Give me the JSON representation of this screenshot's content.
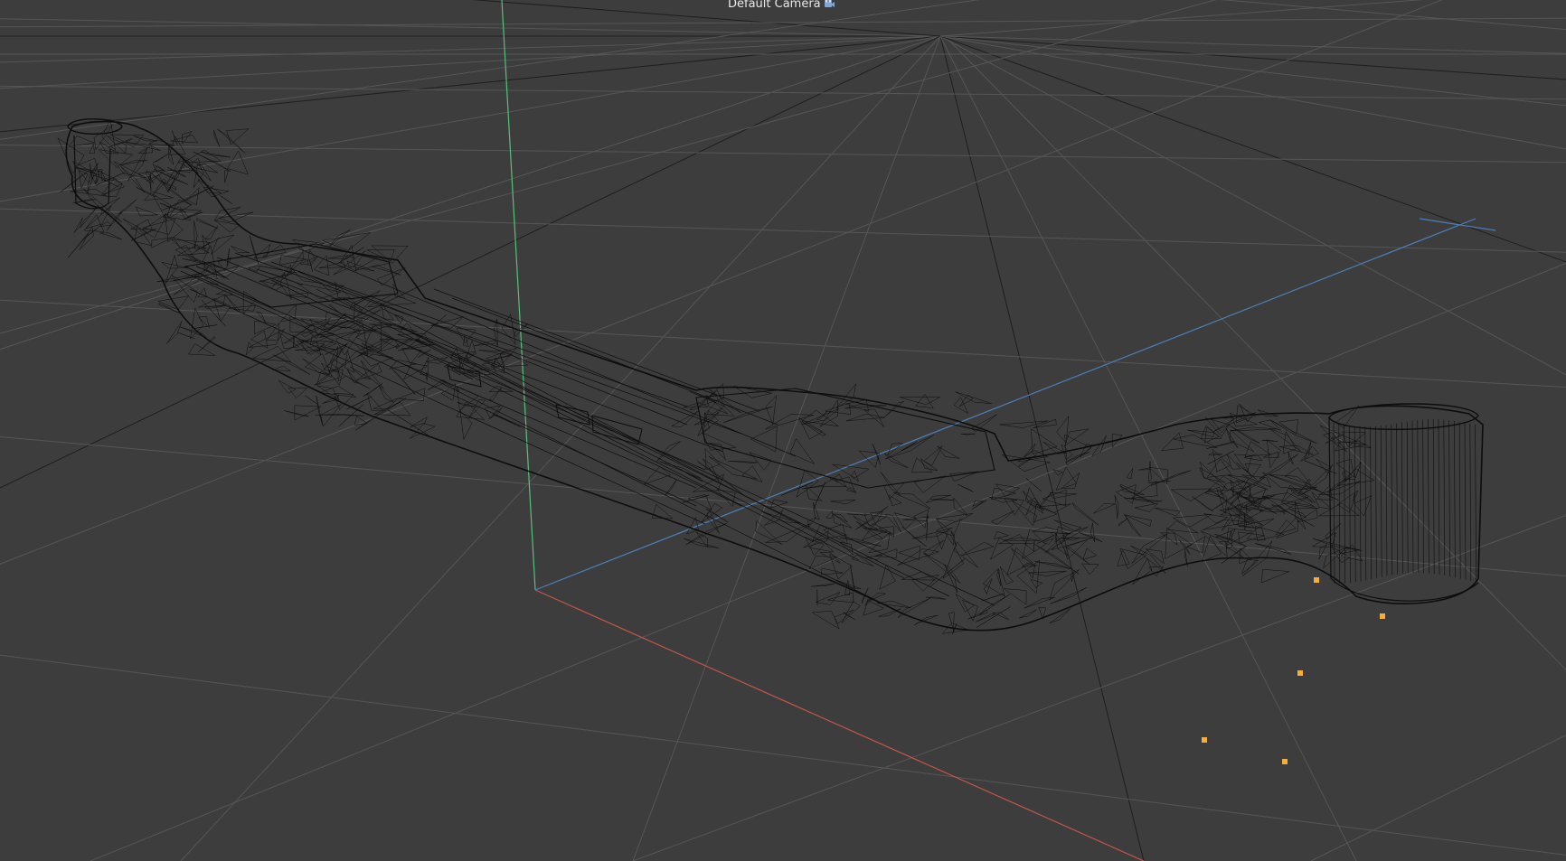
{
  "viewport": {
    "camera_label": "Default Camera",
    "camera_icon": "camera-icon",
    "background_color": "#3d3d3d",
    "grid": true
  },
  "colors": {
    "grid_line": "#565656",
    "grid_major": "#1e1e1e",
    "axis_x": "#c4564a",
    "axis_y": "#57c07e",
    "axis_z": "#4e7fb8",
    "wireframe": "#0d0d0d",
    "handle": "#f7ad3c"
  },
  "scene": {
    "object": "wireframe-mesh",
    "selected_point_count": 5
  }
}
